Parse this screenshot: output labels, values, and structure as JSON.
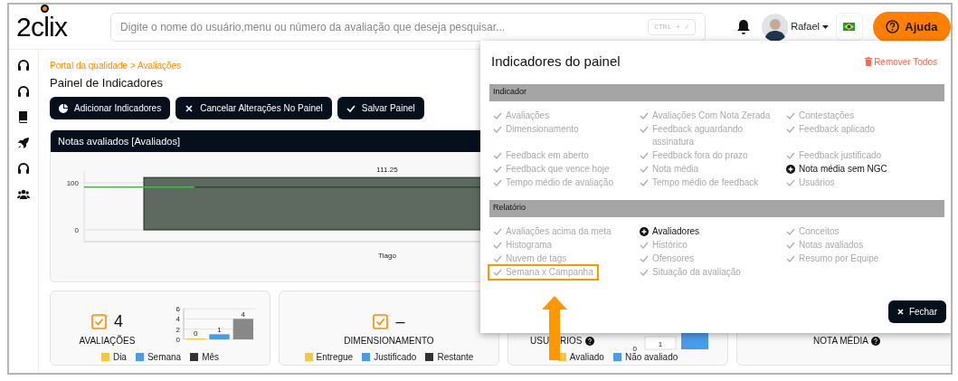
{
  "header": {
    "logo": "2clix",
    "search": {
      "placeholder": "Digite o nome do usuário,menu ou número da avaliação que deseja pesquisar...",
      "shortcut": "CTRL + /"
    },
    "user": {
      "name": "Rafael"
    },
    "help_button": "Ajuda"
  },
  "sidebar": {
    "items": [
      {
        "kind": "headphones"
      },
      {
        "kind": "headphones"
      },
      {
        "kind": "book"
      },
      {
        "kind": "rocket"
      },
      {
        "kind": "headphones"
      },
      {
        "kind": "users"
      }
    ]
  },
  "breadcrumb": "Portal da qualidade > Avaliações",
  "page_title": "Painel de Indicadores",
  "toolbar": [
    {
      "kind": "add",
      "label": "Adicionar Indicadores"
    },
    {
      "kind": "cancel",
      "label": "Cancelar Alterações No Painel"
    },
    {
      "kind": "save",
      "label": "Salvar Painel"
    }
  ],
  "chart_panel": {
    "title": "Notas avaliados [Avaliados]",
    "chart_data": {
      "type": "bar",
      "categories": [
        "Tiago"
      ],
      "values": [
        111.25
      ],
      "ylim": [
        -25,
        125
      ],
      "yticks": [
        0,
        100
      ],
      "data_labels": true
    }
  },
  "cards": [
    {
      "checked_icon": true,
      "value": "4",
      "label": "AVALIAÇÕES",
      "help": false,
      "chart_data": {
        "type": "bar",
        "values": [
          0,
          1,
          4
        ],
        "colors": [
          "#f3c742",
          "#4a9be8",
          "#888888"
        ],
        "ylim": [
          0,
          6
        ],
        "yticks": [
          0,
          2,
          4,
          6
        ],
        "data_labels": true
      },
      "legend": [
        {
          "label": "Dia",
          "color": "#f3c742"
        },
        {
          "label": "Semana",
          "color": "#4a9be8"
        },
        {
          "label": "Mês",
          "color": "#333333"
        }
      ]
    },
    {
      "checked_icon": true,
      "value": "–",
      "label": "DIMENSIONAMENTO",
      "help": false,
      "legend": [
        {
          "label": "Entregue",
          "color": "#f3c742"
        },
        {
          "label": "Justificado",
          "color": "#4a9be8"
        },
        {
          "label": "Restante",
          "color": "#333333"
        }
      ]
    },
    {
      "checked_icon": false,
      "label_parts": [
        "USU",
        "RIOS"
      ],
      "help": true,
      "partial_chart": {
        "tick": "0",
        "bar_label": "1"
      },
      "legend": [
        {
          "label": "Avaliado",
          "color": "#f3c742"
        },
        {
          "label": "Não avaliado",
          "color": "#4a9be8"
        }
      ]
    },
    {
      "checked_icon": false,
      "label": "NOTA MÉDIA",
      "help": true
    }
  ],
  "modal": {
    "title": "Indicadores do painel",
    "remove_all": "Remover Todos",
    "close_button": "Fechar",
    "sections": [
      {
        "title": "Indicador",
        "items": [
          {
            "label": "Avaliações",
            "added": true,
            "highlighted": false
          },
          {
            "label": "Avaliações Com Nota Zerada",
            "added": true,
            "highlighted": false
          },
          {
            "label": "Contestações",
            "added": true,
            "highlighted": false
          },
          {
            "label": "Dimensionamento",
            "added": true,
            "highlighted": false
          },
          {
            "label": "Feedback aguardando assinatura",
            "added": true,
            "highlighted": false
          },
          {
            "label": "Feedback aplicado",
            "added": true,
            "highlighted": false
          },
          {
            "label": "Feedback em aberto",
            "added": true,
            "highlighted": false
          },
          {
            "label": "Feedback fora do prazo",
            "added": true,
            "highlighted": false
          },
          {
            "label": "Feedback justificado",
            "added": true,
            "highlighted": false
          },
          {
            "label": "Feedback que vence hoje",
            "added": true,
            "highlighted": false
          },
          {
            "label": "Nota média",
            "added": true,
            "highlighted": false
          },
          {
            "label": "Nota média sem NGC",
            "added": false,
            "highlighted": false
          },
          {
            "label": "Tempo médio de avaliação",
            "added": true,
            "highlighted": false
          },
          {
            "label": "Tempo médio de feedback",
            "added": true,
            "highlighted": false
          },
          {
            "label": "Usuários",
            "added": true,
            "highlighted": false
          }
        ]
      },
      {
        "title": "Relatório",
        "items": [
          {
            "label": "Avaliações acima da meta",
            "added": true,
            "highlighted": false
          },
          {
            "label": "Avaliadores",
            "added": false,
            "highlighted": false
          },
          {
            "label": "Conceitos",
            "added": true,
            "highlighted": false
          },
          {
            "label": "Histograma",
            "added": true,
            "highlighted": false
          },
          {
            "label": "Histórico",
            "added": true,
            "highlighted": false
          },
          {
            "label": "Notas avaliados",
            "added": true,
            "highlighted": false
          },
          {
            "label": "Nuvem de tags",
            "added": true,
            "highlighted": false
          },
          {
            "label": "Ofensores",
            "added": true,
            "highlighted": false
          },
          {
            "label": "Resumo por Equipe",
            "added": true,
            "highlighted": false
          },
          {
            "label": "Semana x Campanha",
            "added": true,
            "highlighted": true
          },
          {
            "label": "Situação da avaliação",
            "added": true,
            "highlighted": false
          }
        ]
      }
    ]
  }
}
